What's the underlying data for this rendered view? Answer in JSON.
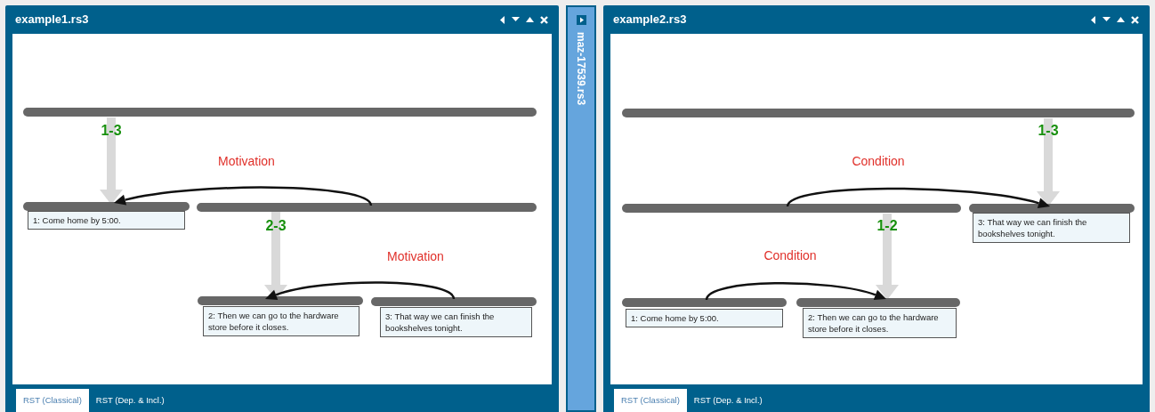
{
  "panels": [
    {
      "title": "example1.rs3",
      "spans": [
        {
          "label": "1-3"
        },
        {
          "label": "2-3"
        }
      ],
      "relations": [
        {
          "name": "Motivation"
        },
        {
          "name": "Motivation"
        }
      ],
      "segments": [
        {
          "text": "1: Come home by 5:00."
        },
        {
          "text": "2: Then we can go to the hardware store before it closes."
        },
        {
          "text": "3: That way we can finish the bookshelves tonight."
        }
      ],
      "tabs": [
        {
          "label": "RST (Classical)",
          "selected": true
        },
        {
          "label": "RST (Dep. & Incl.)",
          "selected": false
        }
      ]
    },
    {
      "title": "example2.rs3",
      "spans": [
        {
          "label": "1-3"
        },
        {
          "label": "1-2"
        }
      ],
      "relations": [
        {
          "name": "Condition"
        },
        {
          "name": "Condition"
        }
      ],
      "segments": [
        {
          "text": "1: Come home by 5:00."
        },
        {
          "text": "2: Then we can go to the hardware store before it closes."
        },
        {
          "text": "3: That way we can finish the bookshelves tonight."
        }
      ],
      "tabs": [
        {
          "label": "RST (Classical)",
          "selected": true
        },
        {
          "label": "RST (Dep. & Incl.)",
          "selected": false
        }
      ]
    }
  ],
  "collapsed_panel": {
    "title": "maz-17539.rs3"
  }
}
